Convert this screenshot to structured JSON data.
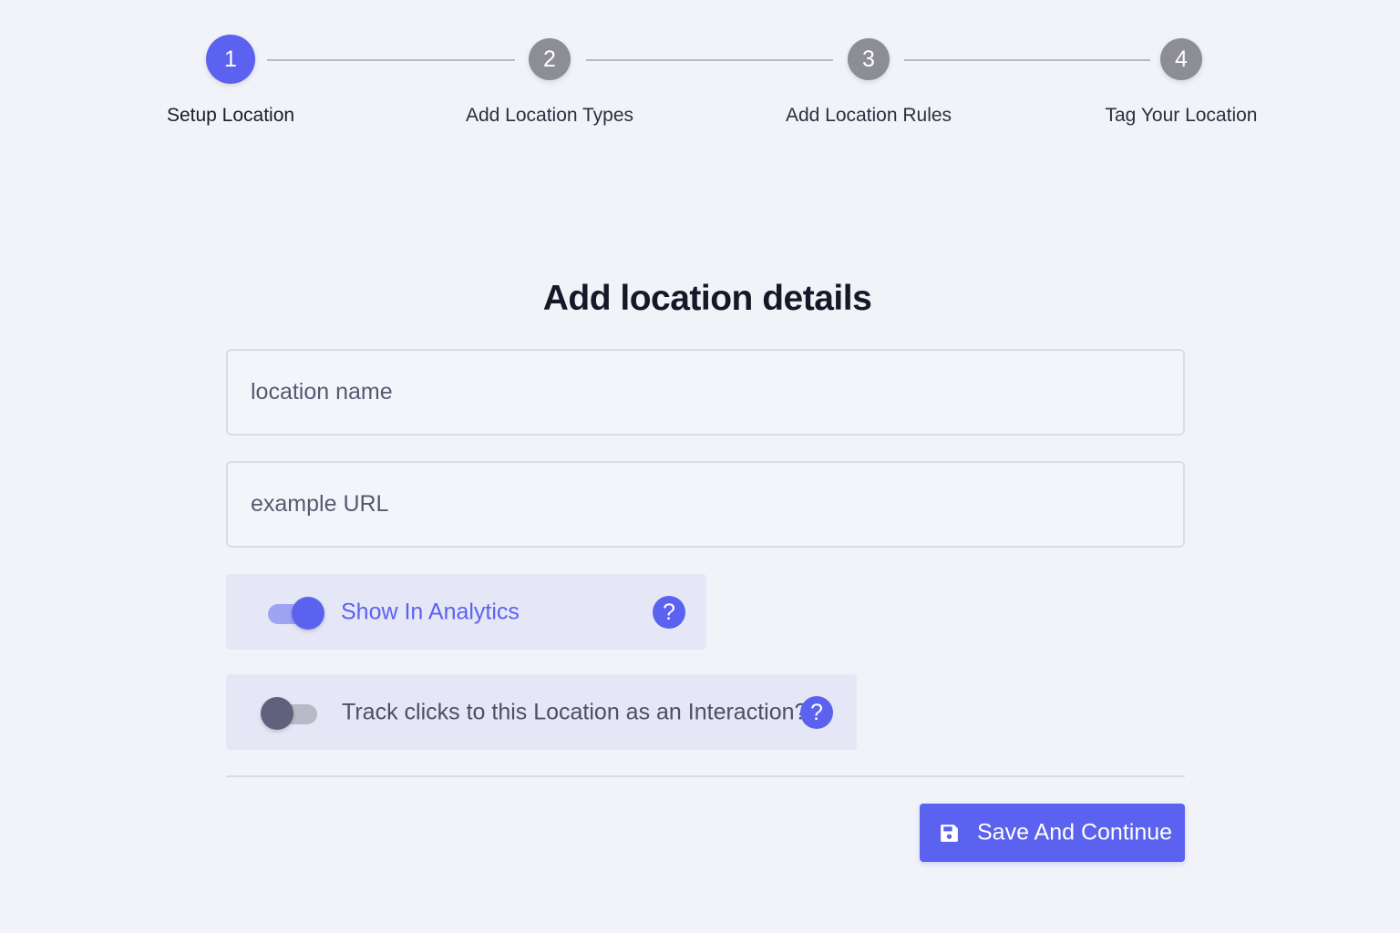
{
  "stepper": {
    "steps": [
      {
        "number": "1",
        "label": "Setup Location",
        "state": "active"
      },
      {
        "number": "2",
        "label": "Add Location Types",
        "state": "inactive"
      },
      {
        "number": "3",
        "label": "Add Location Rules",
        "state": "inactive"
      },
      {
        "number": "4",
        "label": "Tag Your Location",
        "state": "inactive"
      }
    ]
  },
  "form": {
    "title": "Add location details",
    "location_name": {
      "value": "",
      "placeholder": "location name"
    },
    "example_url": {
      "value": "",
      "placeholder": "example URL"
    },
    "show_in_analytics": {
      "label": "Show In Analytics",
      "enabled": true,
      "help_icon": "question-mark-icon"
    },
    "track_clicks": {
      "label": "Track clicks to this Location as an Interaction?",
      "enabled": false,
      "help_icon": "question-mark-icon"
    },
    "save_button": {
      "label": "Save And Continue",
      "icon": "floppy-disk-icon"
    }
  },
  "colors": {
    "accent": "#5b62ef",
    "inactive_step": "#8c8d95",
    "background": "#f2f3f9",
    "toggle_card": "#e5e7f6"
  }
}
